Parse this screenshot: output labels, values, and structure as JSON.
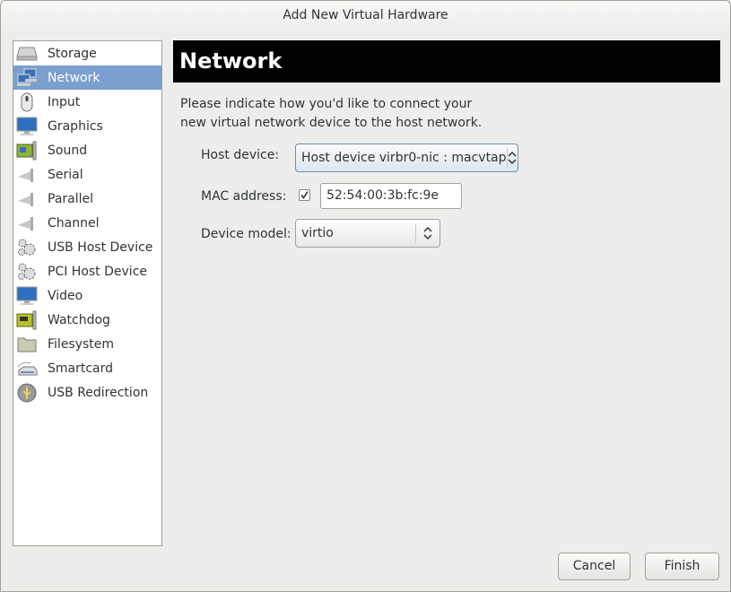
{
  "window": {
    "title": "Add New Virtual Hardware"
  },
  "sidebar": {
    "selected_index": 1,
    "items": [
      {
        "label": "Storage",
        "icon": "hard-drive-icon"
      },
      {
        "label": "Network",
        "icon": "network-icon"
      },
      {
        "label": "Input",
        "icon": "mouse-icon"
      },
      {
        "label": "Graphics",
        "icon": "monitor-icon"
      },
      {
        "label": "Sound",
        "icon": "sound-card-icon"
      },
      {
        "label": "Serial",
        "icon": "serial-port-icon"
      },
      {
        "label": "Parallel",
        "icon": "parallel-port-icon"
      },
      {
        "label": "Channel",
        "icon": "channel-icon"
      },
      {
        "label": "USB Host Device",
        "icon": "usb-host-gears-icon"
      },
      {
        "label": "PCI Host Device",
        "icon": "pci-host-gears-icon"
      },
      {
        "label": "Video",
        "icon": "video-monitor-icon"
      },
      {
        "label": "Watchdog",
        "icon": "watchdog-card-icon"
      },
      {
        "label": "Filesystem",
        "icon": "folder-icon"
      },
      {
        "label": "Smartcard",
        "icon": "smartcard-reader-icon"
      },
      {
        "label": "USB Redirection",
        "icon": "usb-redirection-icon"
      }
    ]
  },
  "main": {
    "title": "Network",
    "description_line1": "Please indicate how you'd like to connect your",
    "description_line2": "new virtual network device to the host network.",
    "host_device": {
      "label": "Host device:",
      "value": "Host device virbr0-nic : macvtap"
    },
    "mac_address": {
      "label": "MAC address:",
      "checked": true,
      "value": "52:54:00:3b:fc:9e"
    },
    "device_model": {
      "label": "Device model:",
      "value": "virtio"
    }
  },
  "buttons": {
    "cancel": "Cancel",
    "finish": "Finish"
  }
}
